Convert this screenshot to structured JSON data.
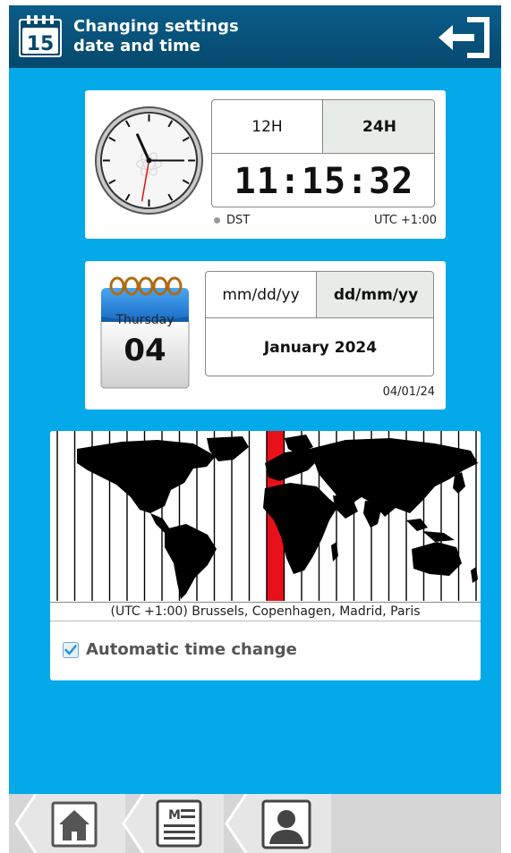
{
  "header": {
    "calendar_icon_day": "15",
    "title": "Changing settings\ndate and time",
    "exit_icon": "exit-icon"
  },
  "clock": {
    "format_12h_label": "12H",
    "format_24h_label": "24H",
    "selected_format": "24H",
    "time": "11:15:32",
    "dst_label": "DST",
    "utc_offset": "UTC +1:00"
  },
  "date": {
    "weekday": "Thursday",
    "day": "04",
    "format_mdy_label": "mm/dd/yy",
    "format_dmy_label": "dd/mm/yy",
    "selected_format": "dd/mm/yy",
    "month_year": "January 2024",
    "short_date": "04/01/24"
  },
  "timezone": {
    "label": "(UTC +1:00) Brussels, Copenhagen, Madrid, Paris",
    "highlight_color": "#e8111a"
  },
  "auto_time_change": {
    "label": "Automatic time change",
    "checked": true
  },
  "nav": {
    "items": [
      {
        "icon": "home-icon"
      },
      {
        "icon": "menu-document-icon"
      },
      {
        "icon": "user-icon"
      }
    ]
  },
  "colors": {
    "background": "#03a9e8",
    "header": "#06486d",
    "check": "#2a8fd6"
  }
}
